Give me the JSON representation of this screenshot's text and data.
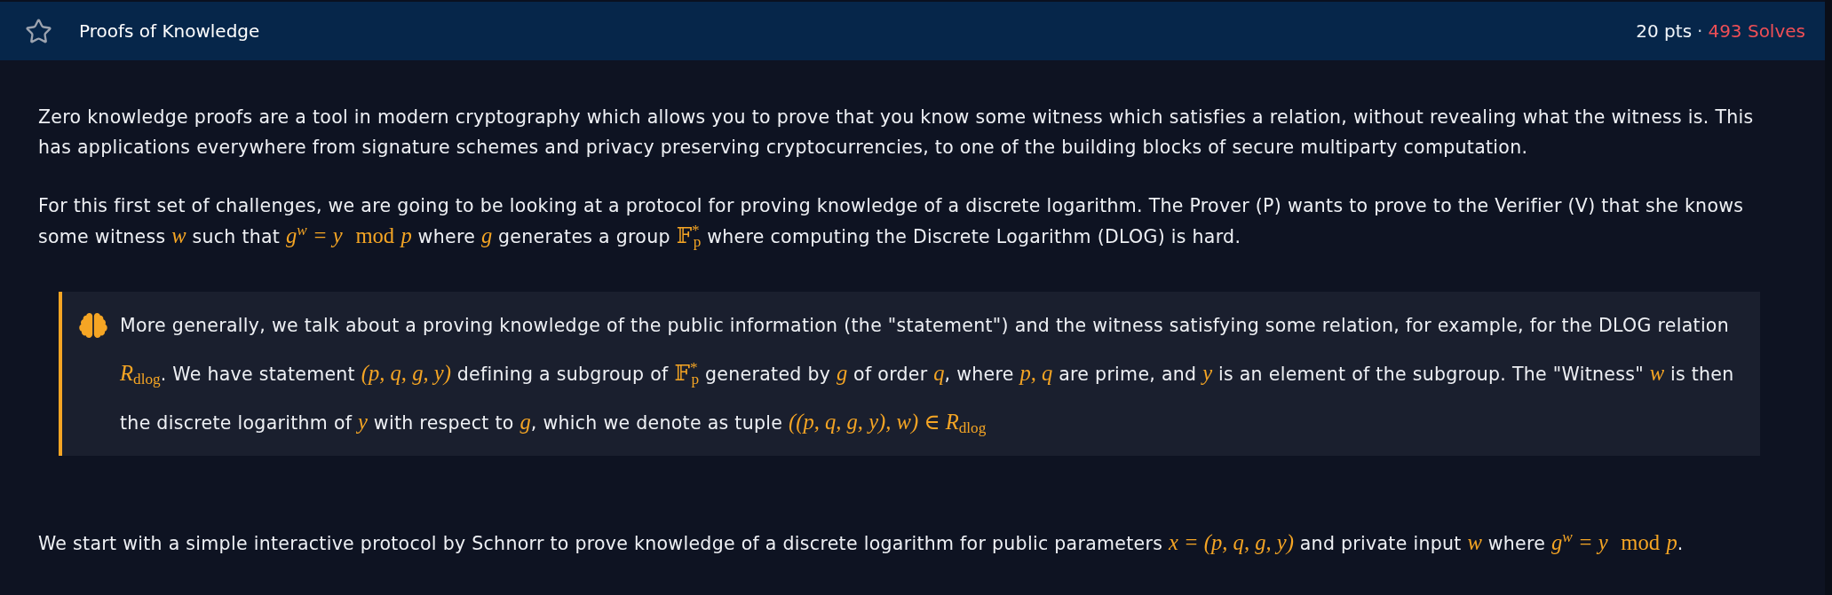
{
  "header": {
    "starred": false,
    "title": "Proofs of Knowledge",
    "points": "20 pts",
    "separator": "·",
    "solves": "493 Solves"
  },
  "content": [
    {
      "kind": "paragraph",
      "segments": [
        {
          "kind": "text",
          "text": "Zero knowledge proofs are a tool in modern cryptography which allows you to prove that you know some witness which satisfies a relation, without revealing what the witness is. This has applications everywhere from signature schemes and privacy preserving cryptocurrencies, to one of the building blocks of secure multiparty computation."
        }
      ]
    },
    {
      "kind": "paragraph",
      "segments": [
        {
          "kind": "text",
          "text": "For this first set of challenges, we are going to be looking at a protocol for proving knowledge of a discrete logarithm. The Prover (P) wants to prove to the Verifier (V) that she knows some witness "
        },
        {
          "kind": "math",
          "text": "w"
        },
        {
          "kind": "text",
          "text": " such that "
        },
        {
          "kind": "math",
          "text": "g$^{w}$ = y"
        },
        {
          "kind": "operator",
          "text": "mod"
        },
        {
          "kind": "math",
          "text": "p"
        },
        {
          "kind": "text",
          "text": " where "
        },
        {
          "kind": "math",
          "text": "g"
        },
        {
          "kind": "text",
          "text": " generates a group "
        },
        {
          "kind": "roman",
          "text": "𝔽$^{*}$$_{p}$"
        },
        {
          "kind": "text",
          "text": " where computing the Discrete Logarithm (DLOG) is hard."
        }
      ]
    },
    {
      "kind": "callout",
      "segments": [
        {
          "kind": "text",
          "text": "More generally, we talk about a proving knowledge of the public information (the \"statement\") and the witness satisfying some relation, for example, for the DLOG relation "
        },
        {
          "kind": "math",
          "text": "R"
        },
        {
          "kind": "roman",
          "text": "$_{dlog}$"
        },
        {
          "kind": "text",
          "text": ". We have statement "
        },
        {
          "kind": "math",
          "text": "(p, q, g, y)"
        },
        {
          "kind": "text",
          "text": " defining a subgroup of "
        },
        {
          "kind": "roman",
          "text": "𝔽$^{*}$$_{p}$"
        },
        {
          "kind": "text",
          "text": " generated by "
        },
        {
          "kind": "math",
          "text": "g"
        },
        {
          "kind": "text",
          "text": " of order "
        },
        {
          "kind": "math",
          "text": "q"
        },
        {
          "kind": "text",
          "text": ", where "
        },
        {
          "kind": "math",
          "text": "p, q"
        },
        {
          "kind": "text",
          "text": " are prime, and "
        },
        {
          "kind": "math",
          "text": "y"
        },
        {
          "kind": "text",
          "text": " is an element of the subgroup. The \"Witness\" "
        },
        {
          "kind": "math",
          "text": "w"
        },
        {
          "kind": "text",
          "text": " is then the discrete logarithm of "
        },
        {
          "kind": "math",
          "text": "y"
        },
        {
          "kind": "text",
          "text": " with respect to "
        },
        {
          "kind": "math",
          "text": "g"
        },
        {
          "kind": "text",
          "text": ", which we denote as tuple "
        },
        {
          "kind": "math",
          "text": "((p, q, g, y), w) ∈ R"
        },
        {
          "kind": "roman",
          "text": "$_{dlog}$"
        }
      ]
    },
    {
      "kind": "paragraph",
      "segments": [
        {
          "kind": "text",
          "text": "We start with a simple interactive protocol by Schnorr to prove knowledge of a discrete logarithm for public parameters "
        },
        {
          "kind": "math",
          "text": "x = (p, q, g, y)"
        },
        {
          "kind": "text",
          "text": " and private input "
        },
        {
          "kind": "math",
          "text": "w"
        },
        {
          "kind": "text",
          "text": " where "
        },
        {
          "kind": "math",
          "text": "g$^{w}$ = y"
        },
        {
          "kind": "operator",
          "text": "mod"
        },
        {
          "kind": "math",
          "text": "p"
        },
        {
          "kind": "text",
          "text": "."
        }
      ]
    }
  ]
}
